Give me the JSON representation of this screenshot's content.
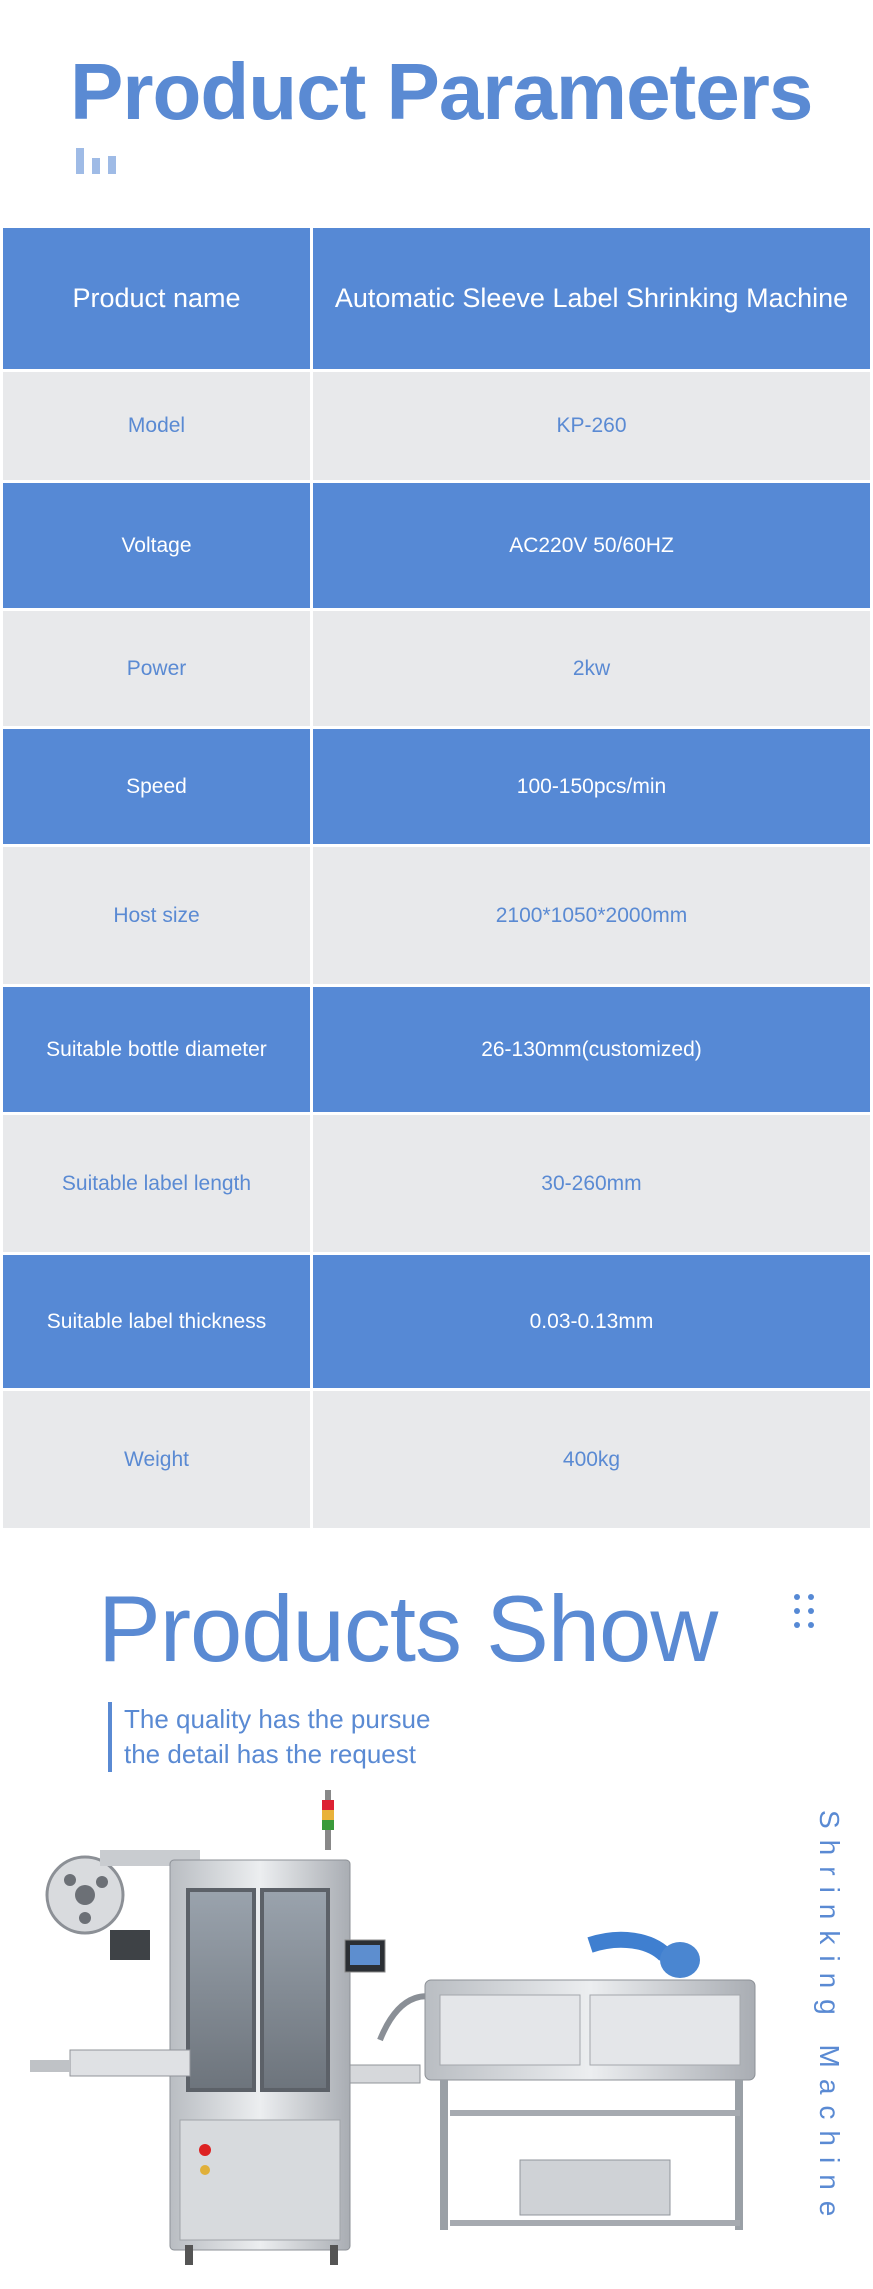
{
  "header": {
    "title": "Product Parameters"
  },
  "params": {
    "header_label": "Product name",
    "header_value": "Automatic Sleeve Label Shrinking Machine",
    "rows": [
      {
        "label": "Model",
        "value": "KP-260"
      },
      {
        "label": "Voltage",
        "value": "AC220V 50/60HZ"
      },
      {
        "label": "Power",
        "value": "2kw"
      },
      {
        "label": "Speed",
        "value": "100-150pcs/min"
      },
      {
        "label": "Host size",
        "value": "2100*1050*2000mm"
      },
      {
        "label": "Suitable bottle diameter",
        "value": "26-130mm(customized)"
      },
      {
        "label": "Suitable label length",
        "value": "30-260mm"
      },
      {
        "label": "Suitable label thickness",
        "value": "0.03-0.13mm"
      },
      {
        "label": "Weight",
        "value": "400kg"
      }
    ]
  },
  "show": {
    "title": "Products Show",
    "tagline_1": "The quality has the pursue",
    "tagline_2": "the detail has the request",
    "vertical_text": "Shrinking Machine",
    "image_alt": "sleeve-label-shrinking-machine"
  },
  "colors": {
    "primary": "#5689d5",
    "title": "#5a8ad3",
    "row_grey": "#e8e9eb"
  }
}
